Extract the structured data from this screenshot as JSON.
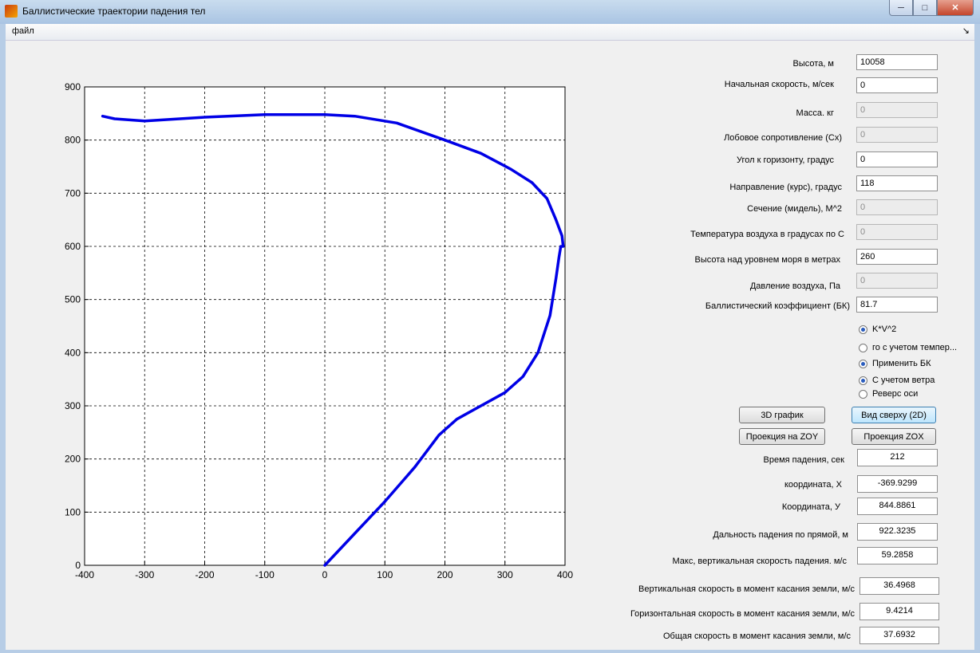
{
  "window": {
    "title": "Баллистические траектории падения тел",
    "minimize": "─",
    "maximize": "□",
    "close": "✕"
  },
  "menu": {
    "file": "файл",
    "overflow": "↘"
  },
  "inputs": [
    {
      "label": "Высота, м",
      "value": "10058",
      "enabled": true
    },
    {
      "label": "Начальная скорость, м/сек",
      "value": "0",
      "enabled": true
    },
    {
      "label": "Масса. кг",
      "value": "0",
      "enabled": false
    },
    {
      "label": "Лобовое сопротивление (Сх)",
      "value": "0",
      "enabled": false
    },
    {
      "label": "Угол к горизонту, градус",
      "value": "0",
      "enabled": true
    },
    {
      "label": "Направление  (курс), градус",
      "value": "118",
      "enabled": true
    },
    {
      "label": "Сечение (мидель), М^2",
      "value": "0",
      "enabled": false
    },
    {
      "label": "Температура воздуха в градусах по С",
      "value": "0",
      "enabled": false
    },
    {
      "label": "Высота над уровнем моря в метрах",
      "value": "260",
      "enabled": true
    },
    {
      "label": "Давление воздуха, Па",
      "value": "0",
      "enabled": false
    },
    {
      "label": "Баллистический коэффициент (БК)",
      "value": "81.7",
      "enabled": true
    }
  ],
  "options": [
    {
      "label": "K*V^2",
      "checked": true
    },
    {
      "label": "го с учетом темпер...",
      "checked": false
    },
    {
      "label": "Применить БК",
      "checked": true
    },
    {
      "label": "С учетом ветра",
      "checked": true
    },
    {
      "label": "Реверс оси",
      "checked": false
    }
  ],
  "buttons": {
    "plot3d": "3D график",
    "top_view": "Вид сверху (2D)",
    "proj_zoy": "Проекция на ZOY",
    "proj_zox": "Проекция ZOX"
  },
  "results": [
    {
      "label": "Время падения, сек",
      "value": "212"
    },
    {
      "label": "координата, Х",
      "value": "-369.9299"
    },
    {
      "label": "Координата, У",
      "value": "844.8861"
    },
    {
      "label": "Дальность падения по прямой, м",
      "value": "922.3235"
    },
    {
      "label": "Макс,  вертикальная скорость падения. м/с",
      "value": "59.2858"
    },
    {
      "label": "Вертикальная  скорость в момент касания земли, м/с",
      "value": "36.4968"
    },
    {
      "label": "Горизонтальная скорость в момент касания земли, м/с",
      "value": "9.4214"
    },
    {
      "label": "Общая скорость в момент касания земли, м/с",
      "value": "37.6932"
    }
  ],
  "colors": {
    "trajectory": "#0000e6",
    "grid": "#000000"
  },
  "chart_data": {
    "type": "line",
    "title": "",
    "xlabel": "",
    "ylabel": "",
    "xlim": [
      -400,
      400
    ],
    "ylim": [
      0,
      900
    ],
    "xticks": [
      -400,
      -300,
      -200,
      -100,
      0,
      100,
      200,
      300,
      400
    ],
    "yticks": [
      0,
      100,
      200,
      300,
      400,
      500,
      600,
      700,
      800,
      900
    ],
    "grid": true,
    "series": [
      {
        "x": [
          0,
          50,
          100,
          150,
          190,
          220,
          260,
          300,
          330,
          355,
          375,
          385,
          390,
          393,
          397,
          395,
          385,
          370,
          345,
          310,
          260,
          200,
          120,
          50,
          0,
          -100,
          -200,
          -300,
          -350,
          -370
        ],
        "y": [
          0,
          60,
          120,
          185,
          245,
          275,
          300,
          325,
          355,
          400,
          470,
          540,
          580,
          600,
          600,
          620,
          650,
          690,
          720,
          745,
          775,
          800,
          832,
          845,
          848,
          848,
          843,
          836,
          840,
          845
        ]
      }
    ]
  }
}
